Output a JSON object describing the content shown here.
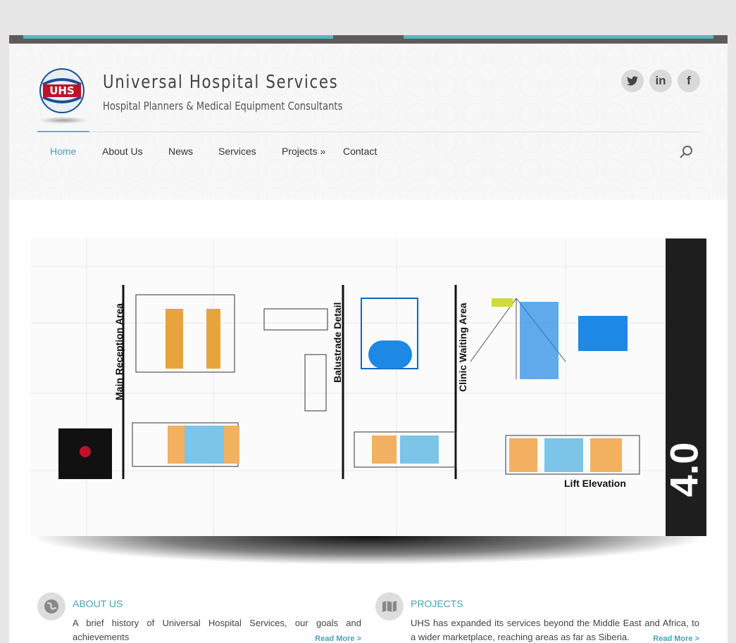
{
  "site": {
    "logo_text": "UHS",
    "title": "Universal Hospital Services",
    "subtitle": "Hospital Planners & Medical Equipment Consultants"
  },
  "social": [
    {
      "name": "twitter",
      "glyph": "🐦"
    },
    {
      "name": "linkedin",
      "glyph": "in"
    },
    {
      "name": "facebook",
      "glyph": "f"
    }
  ],
  "nav": {
    "items": [
      {
        "label": "Home",
        "active": true
      },
      {
        "label": "About Us"
      },
      {
        "label": "News"
      },
      {
        "label": "Services"
      },
      {
        "label": "Projects »"
      },
      {
        "label": "Contact"
      }
    ]
  },
  "slider": {
    "labels": [
      "Main Reception Area",
      "Balustrade Detail",
      "Clinic Waiting Area"
    ],
    "lift_label": "Lift Elevation",
    "version": "4.0"
  },
  "features": [
    {
      "title": "ABOUT US",
      "text": "A brief history of Universal Hospital Services, our goals and achievements",
      "more": "Read More >",
      "icon": "globe-icon"
    },
    {
      "title": "PROJECTS",
      "text": "UHS has expanded its services beyond the Middle East and Africa, to a wider marketplace, reaching areas as far as Siberia.",
      "more": "Read More >",
      "icon": "map-icon"
    }
  ],
  "colors": {
    "accent": "#5fb3c2",
    "link": "#4aa1b4",
    "topbar": "#5e5b5b"
  }
}
